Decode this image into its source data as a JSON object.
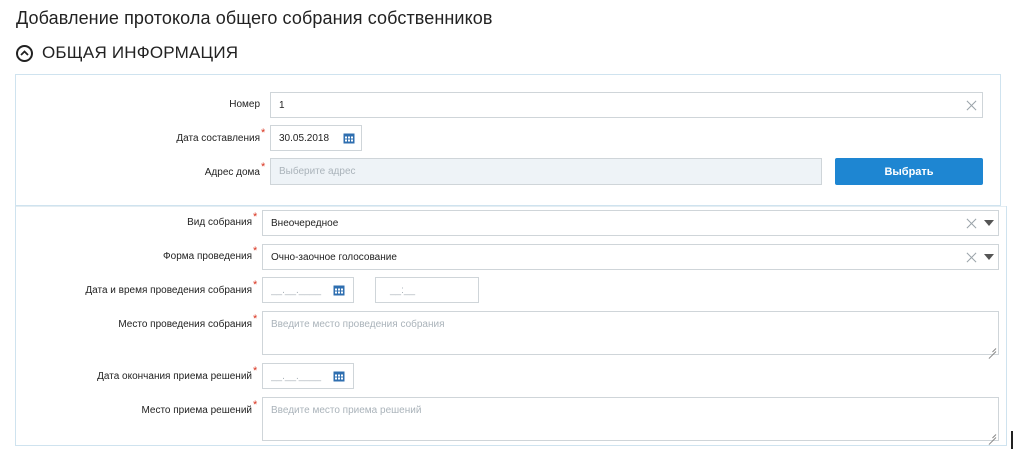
{
  "page": {
    "title": "Добавление протокола общего собрания собственников"
  },
  "section": {
    "title": "ОБЩАЯ ИНФОРМАЦИЯ"
  },
  "form": {
    "number": {
      "label": "Номер",
      "value": "1"
    },
    "compile_date": {
      "label": "Дата составления",
      "value": "30.05.2018"
    },
    "house_address": {
      "label": "Адрес дома",
      "placeholder": "Выберите адрес",
      "button": "Выбрать"
    },
    "meeting_type": {
      "label": "Вид собрания",
      "value": "Внеочередное"
    },
    "meeting_form": {
      "label": "Форма проведения",
      "value": "Очно-заочное голосование"
    },
    "meeting_datetime": {
      "label": "Дата и время проведения собрания",
      "date_placeholder": "__.__.____",
      "time_placeholder": "__:__"
    },
    "meeting_place": {
      "label": "Место проведения собрания",
      "placeholder": "Введите место проведения собрания"
    },
    "decisions_end_date": {
      "label": "Дата окончания приема решений",
      "date_placeholder": "__.__.____"
    },
    "decisions_place": {
      "label": "Место приема решений",
      "placeholder": "Введите место приема решений"
    },
    "required_mark": "*"
  },
  "colors": {
    "accent": "#1e86d2",
    "required": "#d9331f",
    "border": "#cfd5d9"
  },
  "icons": {
    "section_toggle": "chevron-up-circle-icon",
    "calendar": "calendar-icon",
    "clear": "clear-x-icon",
    "dropdown": "caret-down-icon"
  }
}
